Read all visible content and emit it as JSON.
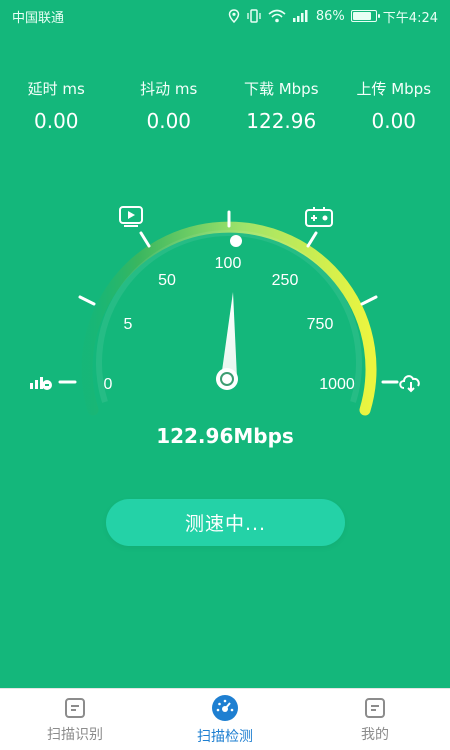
{
  "status_bar": {
    "carrier": "中国联通",
    "battery_pct": "86%",
    "time": "下午4:24",
    "icons": [
      "location-icon",
      "vibrate-icon",
      "wifi-icon",
      "signal-icon",
      "battery-icon"
    ],
    "battery_level": 0.86
  },
  "metrics": [
    {
      "label": "延时 ms",
      "value": "0.00"
    },
    {
      "label": "抖动 ms",
      "value": "0.00"
    },
    {
      "label": "下载 Mbps",
      "value": "122.96"
    },
    {
      "label": "上传 Mbps",
      "value": "0.00"
    }
  ],
  "gauge": {
    "scale_labels": [
      "0",
      "5",
      "50",
      "100",
      "250",
      "750",
      "1000"
    ],
    "current_value_mbps": 122.96,
    "icons": [
      "signal-bars-icon",
      "video-icon",
      "game-controller-icon",
      "cloud-download-icon"
    ],
    "colors": {
      "track_start": "#3ab65f",
      "track_mid": "#9fe36a",
      "track_end": "#ecf53f"
    }
  },
  "speed_readout": "122.96Mbps",
  "button": {
    "label": "测速中..."
  },
  "tabs": [
    {
      "label": "扫描识别",
      "icon": "document-icon",
      "active": false
    },
    {
      "label": "扫描检测",
      "icon": "speedometer-icon",
      "active": true
    },
    {
      "label": "我的",
      "icon": "document-icon",
      "active": false
    }
  ],
  "colors": {
    "background": "#14b77b",
    "button": "#24d2a7",
    "tab_active": "#1e7fd1",
    "tab_inactive": "#8c8c8c"
  }
}
